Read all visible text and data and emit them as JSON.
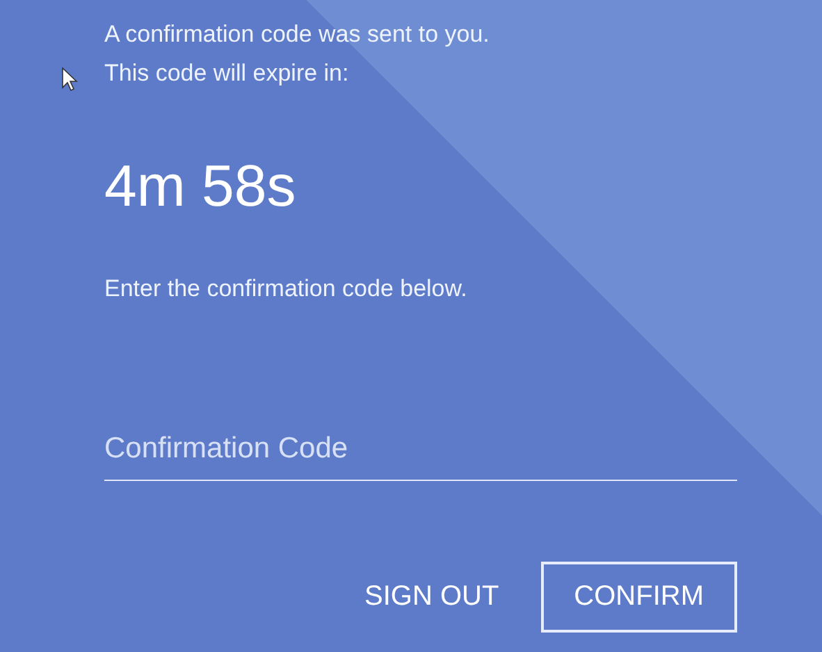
{
  "message_lines": [
    "A confirmation code was sent to you.",
    "This code will expire in:"
  ],
  "countdown": "4m 58s",
  "instruction": "Enter the confirmation code below.",
  "code_field": {
    "placeholder": "Confirmation Code"
  },
  "buttons": [
    {
      "label": "SIGN OUT",
      "kind": "text"
    },
    {
      "label": "CONFIRM",
      "kind": "outlined"
    }
  ]
}
